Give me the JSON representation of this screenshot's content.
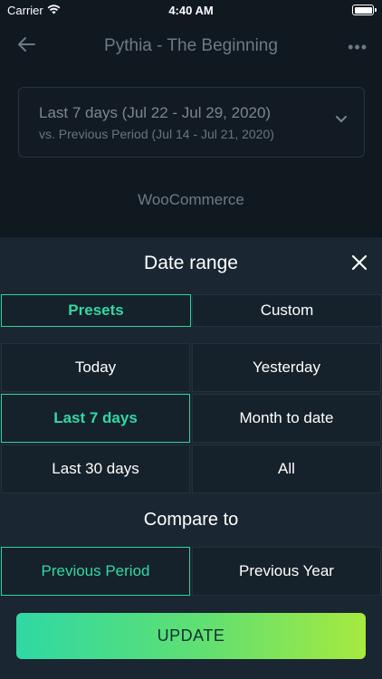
{
  "status_bar": {
    "carrier": "Carrier",
    "time": "4:40 AM"
  },
  "nav": {
    "title": "Pythia - The Beginning",
    "more": "•••"
  },
  "range_card": {
    "main": "Last 7 days (Jul 22 - Jul 29, 2020)",
    "sub": "vs. Previous Period (Jul 14 - Jul 21, 2020)"
  },
  "section_label": "WooCommerce",
  "sheet": {
    "title": "Date range",
    "tabs": [
      {
        "label": "Presets",
        "selected": true
      },
      {
        "label": "Custom",
        "selected": false
      }
    ],
    "presets": [
      {
        "label": "Today",
        "selected": false
      },
      {
        "label": "Yesterday",
        "selected": false
      },
      {
        "label": "Last 7 days",
        "selected": true
      },
      {
        "label": "Month to date",
        "selected": false
      },
      {
        "label": "Last 30 days",
        "selected": false
      },
      {
        "label": "All",
        "selected": false
      }
    ],
    "compare_label": "Compare to",
    "compare_options": [
      {
        "label": "Previous Period",
        "selected": true
      },
      {
        "label": "Previous Year",
        "selected": false
      }
    ],
    "update_label": "UPDATE"
  },
  "colors": {
    "accent": "#2fd3a0",
    "sheet_bg": "#1a2631",
    "gradient_start": "#2fd8a4",
    "gradient_end": "#a6ea3e"
  },
  "icons": [
    "wifi-icon",
    "battery-icon",
    "back-arrow-icon",
    "more-icon",
    "chevron-down-icon",
    "close-icon"
  ]
}
